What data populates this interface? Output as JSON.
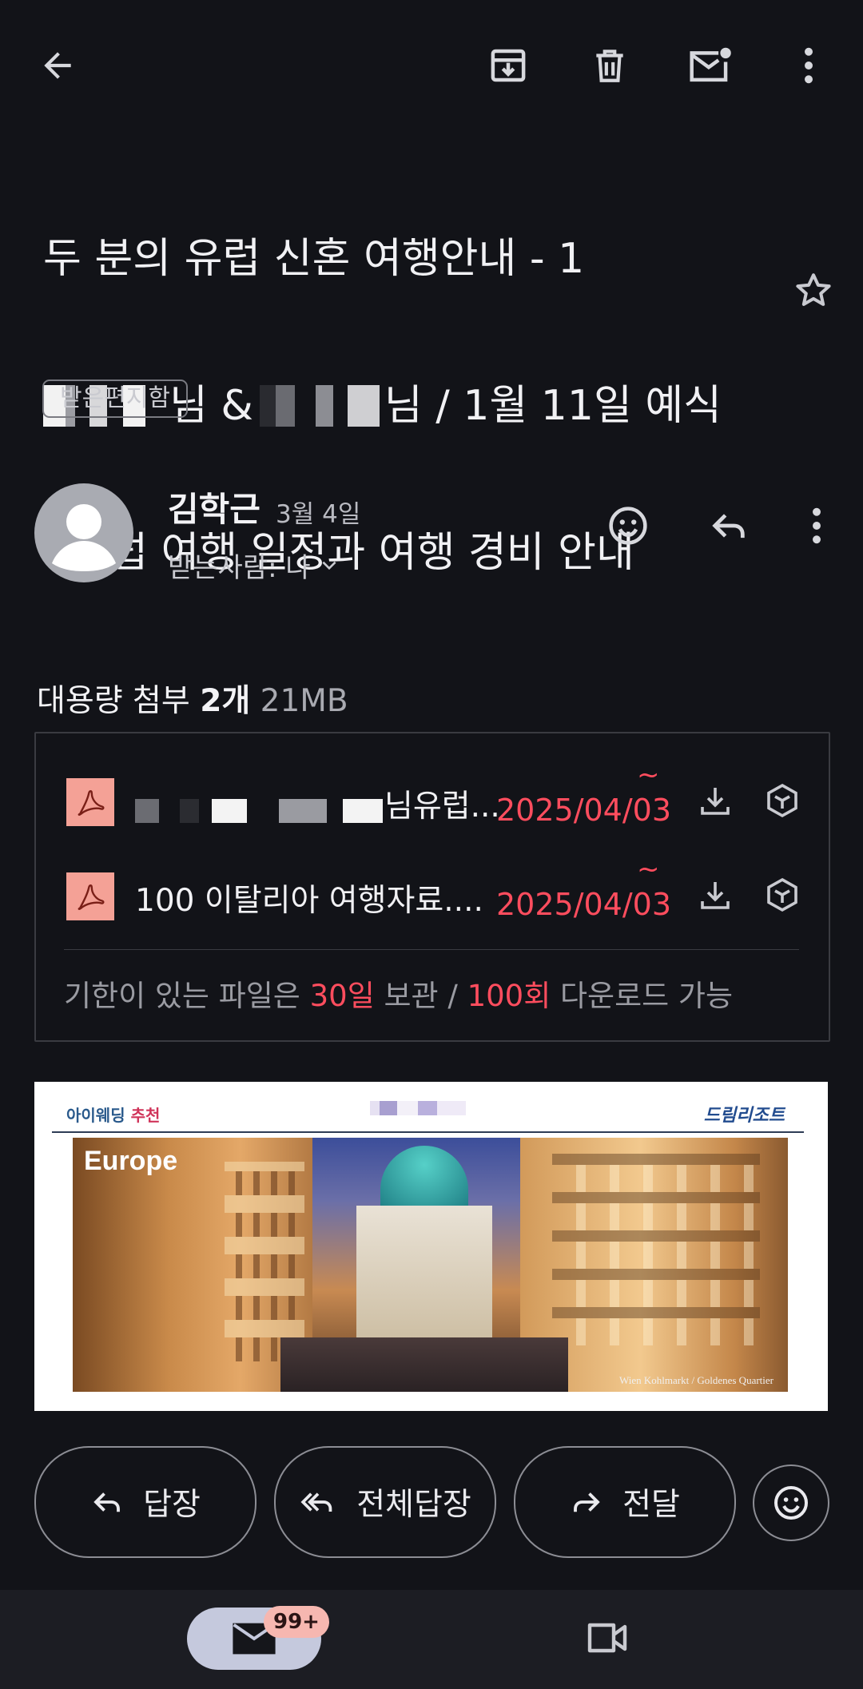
{
  "topbar": {
    "back_icon": "arrow-back-icon",
    "actions": [
      "archive-icon",
      "delete-icon",
      "mark-unread-icon",
      "more-vert-icon"
    ]
  },
  "subject": {
    "line1": "두 분의 유럽 신혼 여행안내 - 1",
    "line2_a": "님 & ",
    "line2_b": "님 / 1월 11일 예식",
    "line3": "- 유럽 여행 일정과 여행 경비 안내",
    "label": "받은편지함",
    "star_icon": "star-outline-icon"
  },
  "sender": {
    "name": "김학근",
    "date": "3월 4일",
    "recipient": "받는사람: 나",
    "actions": [
      "emoji-icon",
      "reply-icon",
      "more-vert-icon"
    ]
  },
  "attachments": {
    "heading_prefix": "대용량 첨부",
    "count": "2개",
    "size": "21MB",
    "files": [
      {
        "name_visible": "님유럽...",
        "tilde": "~",
        "expiry": "2025/04/03"
      },
      {
        "name_visible": "100 이탈리아 여행자료....",
        "tilde": "~",
        "expiry": "2025/04/03"
      }
    ],
    "note_a": "기한이 있는 파일은 ",
    "note_days": "30일",
    "note_b": " 보관 / ",
    "note_count": "100회",
    "note_c": " 다운로드 가능"
  },
  "body_image": {
    "logo_left_a": "아이웨딩 ",
    "logo_left_b": "추천",
    "logo_right": "드림리조트",
    "hero_title": "Europe",
    "caption": "Wien Kohlmarkt / Goldenes Quartier"
  },
  "actions": {
    "reply": "답장",
    "reply_all": "전체답장",
    "forward": "전달"
  },
  "bottom_nav": {
    "mail_badge": "99+",
    "icons": [
      "mail-icon",
      "video-icon"
    ]
  },
  "colors": {
    "background": "#121318",
    "accent_red": "#ff4d5e",
    "badge": "#f6b7b0",
    "nav_active": "#c5c9dd"
  }
}
